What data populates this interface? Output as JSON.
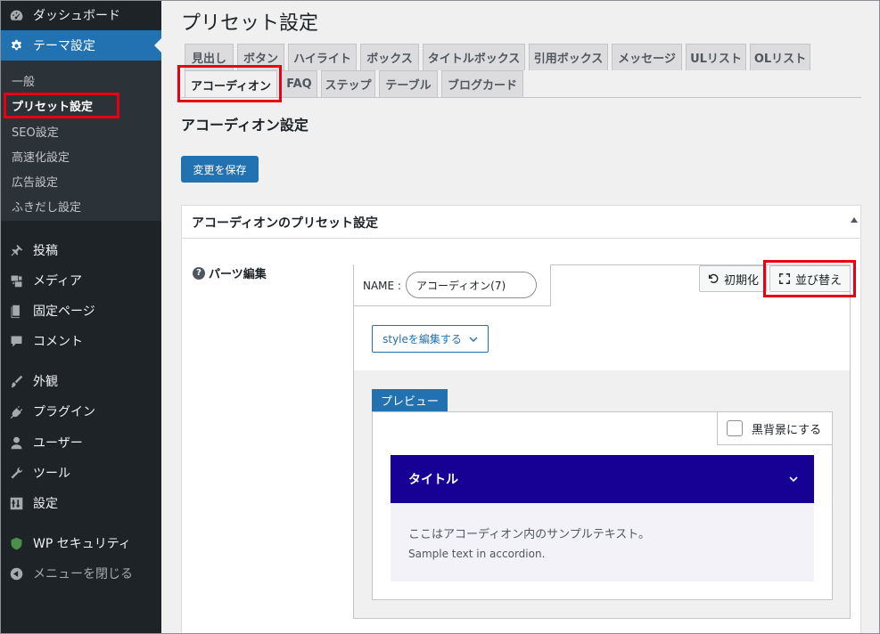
{
  "sidebar": {
    "items": [
      {
        "label": "ダッシュボード",
        "icon": "dashboard-icon"
      },
      {
        "label": "テーマ設定",
        "icon": "gear-icon"
      },
      {
        "label": "投稿",
        "icon": "pin-icon"
      },
      {
        "label": "メディア",
        "icon": "media-icon"
      },
      {
        "label": "固定ページ",
        "icon": "page-icon"
      },
      {
        "label": "コメント",
        "icon": "comment-icon"
      },
      {
        "label": "外観",
        "icon": "brush-icon"
      },
      {
        "label": "プラグイン",
        "icon": "plugin-icon"
      },
      {
        "label": "ユーザー",
        "icon": "user-icon"
      },
      {
        "label": "ツール",
        "icon": "wrench-icon"
      },
      {
        "label": "設定",
        "icon": "settings-icon"
      },
      {
        "label": "WP セキュリティ",
        "icon": "shield-icon"
      },
      {
        "label": "メニューを閉じる",
        "icon": "collapse-icon"
      }
    ],
    "submenu": [
      "一般",
      "プリセット設定",
      "SEO設定",
      "高速化設定",
      "広告設定",
      "ふきだし設定"
    ]
  },
  "main": {
    "title": "プリセット設定",
    "tabs": [
      "見出し",
      "ボタン",
      "ハイライト",
      "ボックス",
      "タイトルボックス",
      "引用ボックス",
      "メッセージ",
      "ULリスト",
      "OLリスト",
      "アコーディオン",
      "FAQ",
      "ステップ",
      "テーブル",
      "ブログカード"
    ],
    "section_title": "アコーディオン設定",
    "save_button": "変更を保存"
  },
  "panel": {
    "title": "アコーディオンのプリセット設定",
    "parts_label": "パーツ編集",
    "name_label": "NAME :",
    "name_value": "アコーディオン(7)",
    "reset_button": "初期化",
    "sort_button": "並び替え",
    "style_edit": "styleを編集する",
    "preview_label": "プレビュー",
    "dark_bg": "黒背景にする",
    "accordion_title": "タイトル",
    "accordion_text_ja": "ここはアコーディオン内のサンプルテキスト。",
    "accordion_text_en": "Sample text in accordion."
  },
  "colors": {
    "sidebar_bg": "#1d2327",
    "active": "#2271b1",
    "accordion_head": "#170094",
    "highlight_border": "#e60012"
  }
}
